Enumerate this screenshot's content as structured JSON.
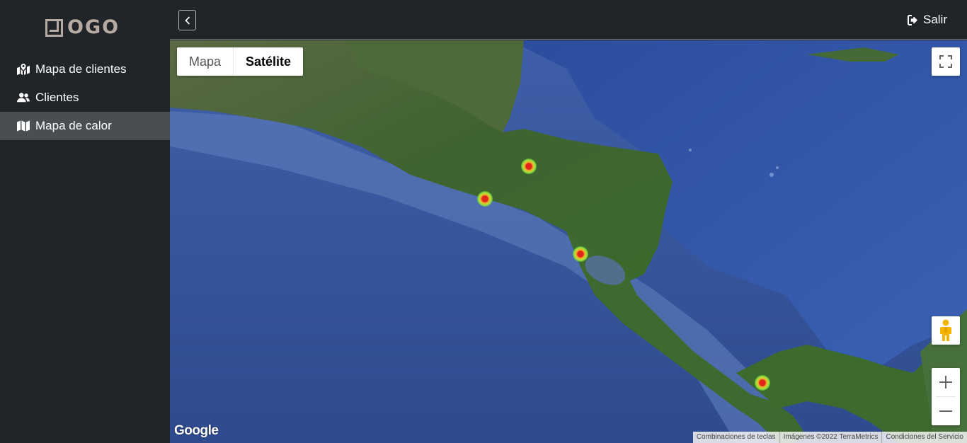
{
  "logo": {
    "text": "OGO"
  },
  "sidebar": {
    "items": [
      {
        "label": "Mapa de clientes",
        "icon": "map-marked-icon",
        "active": false
      },
      {
        "label": "Clientes",
        "icon": "users-icon",
        "active": false
      },
      {
        "label": "Mapa de calor",
        "icon": "map-icon",
        "active": true
      }
    ]
  },
  "topbar": {
    "toggle_icon": "chevron-left-icon",
    "logout_label": "Salir",
    "logout_icon": "sign-out-icon"
  },
  "map": {
    "type_map_label": "Mapa",
    "type_satellite_label": "Satélite",
    "selected_type": "Satélite",
    "google_label": "Google",
    "attribution": {
      "shortcuts": "Combinaciones de teclas",
      "imagery": "Imágenes ©2022 TerraMetrics",
      "terms": "Condiciones del Servicio"
    },
    "heat_colors": {
      "core": "#e0251a",
      "mid": "#f3b12a",
      "outer": "#a6e33a"
    }
  },
  "colors": {
    "sidebar_bg": "#212529",
    "active_item_bg": "#4a4d51",
    "text": "#ffffff"
  }
}
